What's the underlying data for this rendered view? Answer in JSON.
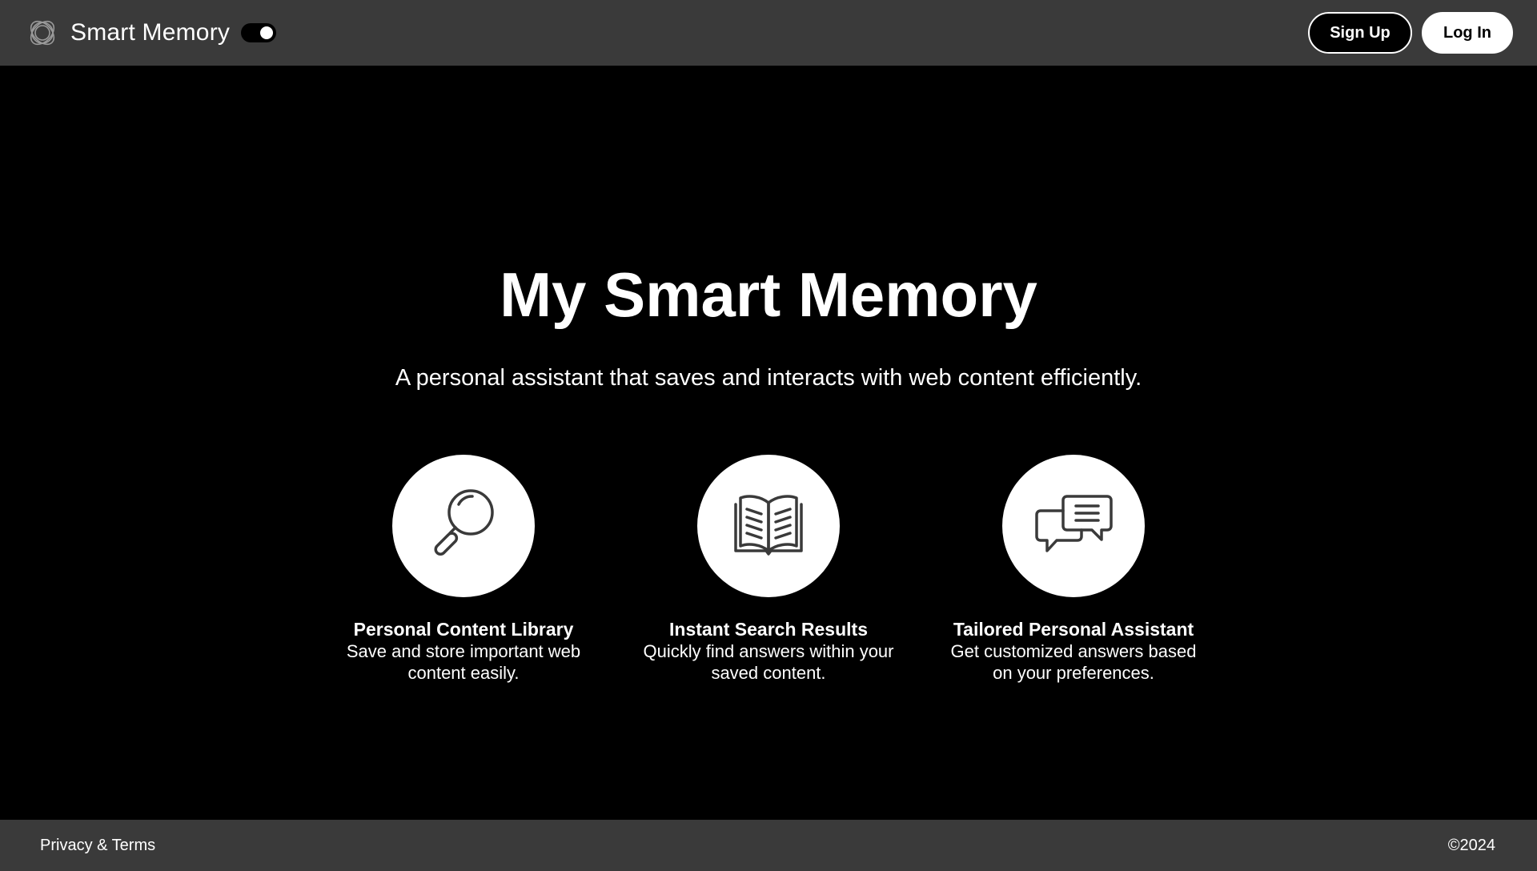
{
  "header": {
    "app_name": "Smart Memory",
    "sign_up_label": "Sign Up",
    "log_in_label": "Log In",
    "theme_toggle_on": true
  },
  "hero": {
    "title": "My Smart Memory",
    "subtitle": "A personal assistant that saves and interacts with web content efficiently."
  },
  "features": [
    {
      "icon": "magnifying-glass-icon",
      "title": "Personal Content Library",
      "desc_line1": "Save and store important web",
      "desc_line2": "content easily."
    },
    {
      "icon": "open-book-icon",
      "title": "Instant Search Results",
      "desc_line1": "Quickly find answers within your",
      "desc_line2": "saved content."
    },
    {
      "icon": "chat-bubbles-icon",
      "title": "Tailored Personal Assistant",
      "desc_line1": "Get customized answers based",
      "desc_line2": "on your preferences."
    }
  ],
  "footer": {
    "privacy_label": "Privacy & Terms",
    "copyright": "©2024"
  },
  "colors": {
    "background": "#000000",
    "bar": "#3a3a3a",
    "text": "#ffffff",
    "icon_stroke": "#3a3a3a"
  }
}
